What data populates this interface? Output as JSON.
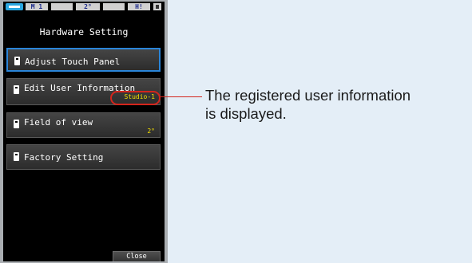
{
  "status_bar": {
    "mode": "M 1",
    "field_of_view": "2°",
    "indicator": "H!"
  },
  "header": {
    "title": "Hardware Setting"
  },
  "menu": {
    "items": [
      {
        "label": "Adjust Touch Panel",
        "value": ""
      },
      {
        "label": "Edit User Information",
        "value": "Studio-1"
      },
      {
        "label": "Field of view",
        "value": "2°"
      },
      {
        "label": "Factory Setting",
        "value": ""
      }
    ],
    "close_label": "Close"
  },
  "annotation": {
    "line1": "The registered user information",
    "line2": "is displayed."
  },
  "colors": {
    "background": "#e4eef7",
    "screen": "#000000",
    "selected_border": "#2a85d9",
    "value_text": "#f4e000",
    "callout": "#d4251c"
  },
  "icons": [
    "battery-icon",
    "memory-card-icon",
    "menu-item-icon"
  ]
}
